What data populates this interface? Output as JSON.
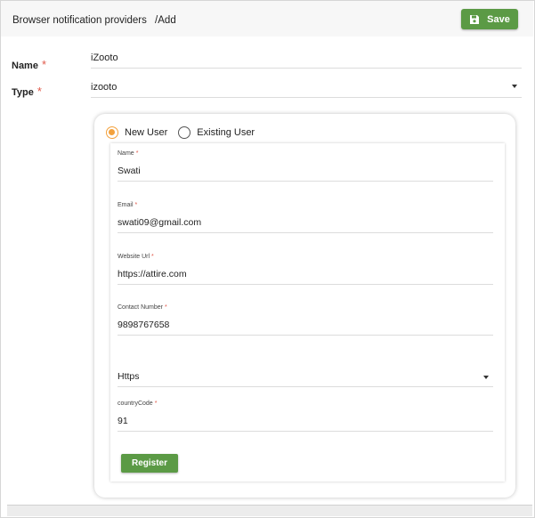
{
  "header": {
    "breadcrumb_parent": "Browser notification providers",
    "breadcrumb_separator": "/",
    "breadcrumb_current": "Add",
    "save_label": "Save"
  },
  "form": {
    "name_label": "Name",
    "name_required": "*",
    "name_value": "iZooto",
    "type_label": "Type",
    "type_required": "*",
    "type_value": "izooto"
  },
  "provider_card": {
    "radio_new_user": "New User",
    "radio_existing_user": "Existing User",
    "selected_option": "New User",
    "required_mark": "*",
    "fields": {
      "name": {
        "label": "Name",
        "value": "Swati"
      },
      "email": {
        "label": "Email",
        "value": "swati09@gmail.com"
      },
      "website_url": {
        "label": "Website Url",
        "value": "https://attire.com"
      },
      "contact_number": {
        "label": "Contact Number",
        "value": "9898767658"
      },
      "protocol": {
        "value": "Https"
      },
      "country_code": {
        "label": "countryCode",
        "value": "91"
      }
    },
    "register_label": "Register"
  },
  "colors": {
    "accent_green": "#5b9a45",
    "radio_orange": "#f3a13c",
    "required_red": "#e05a4b"
  }
}
